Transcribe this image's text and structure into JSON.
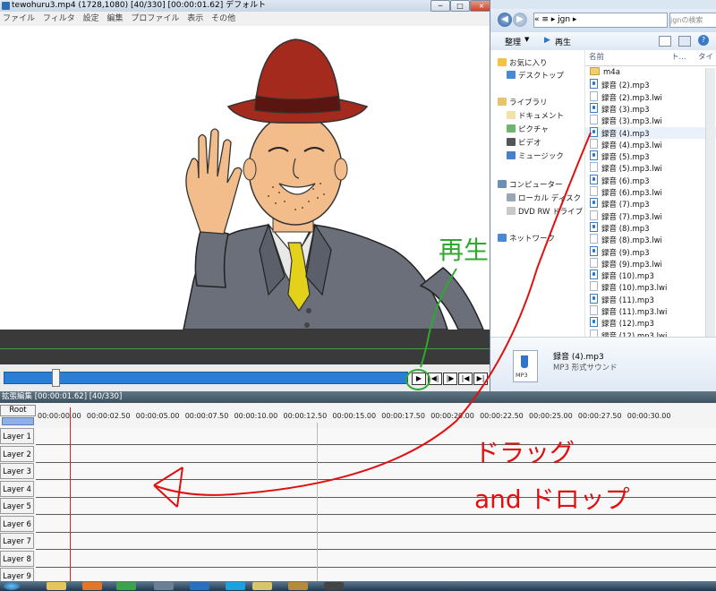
{
  "main": {
    "title": "tewohuru3.mp4 (1728,1080)  [40/330]  [00:00:01.62]  デフォルト",
    "controls": {
      "minimize": "─",
      "maximize": "□",
      "close": "×"
    },
    "menu": [
      "ファイル",
      "フィルタ",
      "設定",
      "編集",
      "プロファイル",
      "表示",
      "その他"
    ],
    "playback": {
      "play": "▶",
      "prev_frame": "◀|",
      "next_frame": "|▶",
      "to_start": "|◀",
      "to_end": "▶|"
    },
    "seek_position": 0.12
  },
  "explorer": {
    "path": "«  ≡  ▸ jgn  ▸",
    "search_placeholder": "jgnの検索",
    "toolbar": {
      "organize": "整理",
      "play": "再生"
    },
    "nav": {
      "favorites": "お気に入り",
      "desktop": "デスクトップ",
      "libraries": "ライブラリ",
      "documents": "ドキュメント",
      "pictures": "ピクチャ",
      "videos": "ビデオ",
      "music": "ミュージック",
      "computer": "コンピューター",
      "local_disk": "ローカル ディスク",
      "dvd_drive": "DVD RW ドライブ",
      "network": "ネットワーク"
    },
    "columns": {
      "name": "名前",
      "track": "ト...",
      "title": "タイ"
    },
    "files": [
      {
        "name": "m4a",
        "type": "folder"
      },
      {
        "name": "録音 (2).mp3",
        "type": "mp3"
      },
      {
        "name": "録音 (2).mp3.lwi",
        "type": "lwi"
      },
      {
        "name": "録音 (3).mp3",
        "type": "mp3"
      },
      {
        "name": "録音 (3).mp3.lwi",
        "type": "lwi"
      },
      {
        "name": "録音 (4).mp3",
        "type": "mp3"
      },
      {
        "name": "録音 (4).mp3.lwi",
        "type": "lwi"
      },
      {
        "name": "録音 (5).mp3",
        "type": "mp3"
      },
      {
        "name": "録音 (5).mp3.lwi",
        "type": "lwi"
      },
      {
        "name": "録音 (6).mp3",
        "type": "mp3"
      },
      {
        "name": "録音 (6).mp3.lwi",
        "type": "lwi"
      },
      {
        "name": "録音 (7).mp3",
        "type": "mp3"
      },
      {
        "name": "録音 (7).mp3.lwi",
        "type": "lwi"
      },
      {
        "name": "録音 (8).mp3",
        "type": "mp3"
      },
      {
        "name": "録音 (8).mp3.lwi",
        "type": "lwi"
      },
      {
        "name": "録音 (9).mp3",
        "type": "mp3"
      },
      {
        "name": "録音 (9).mp3.lwi",
        "type": "lwi"
      },
      {
        "name": "録音 (10).mp3",
        "type": "mp3"
      },
      {
        "name": "録音 (10).mp3.lwi",
        "type": "lwi"
      },
      {
        "name": "録音 (11).mp3",
        "type": "mp3"
      },
      {
        "name": "録音 (11).mp3.lwi",
        "type": "lwi"
      },
      {
        "name": "録音 (12).mp3",
        "type": "mp3"
      },
      {
        "name": "録音 (12).mp3.lwi",
        "type": "lwi"
      }
    ],
    "details": {
      "name": "録音 (4).mp3",
      "type": "MP3 形式サウンド",
      "icon_text": "MP3"
    }
  },
  "timeline": {
    "title": "拡張編集 [00:00:01.62] [40/330]",
    "root": "Root",
    "ticks": [
      "00:00:00.00",
      "00:00:02.50",
      "00:00:05.00",
      "00:00:07.50",
      "00:00:10.00",
      "00:00:12.50",
      "00:00:15.00",
      "00:00:17.50",
      "00:00:20.00",
      "00:00:22.50",
      "00:00:25.00",
      "00:00:27.50",
      "00:00:30.00"
    ],
    "layers": [
      "Layer 1",
      "Layer 2",
      "Layer 3",
      "Layer 4",
      "Layer 5",
      "Layer 6",
      "Layer 7",
      "Layer 8",
      "Layer 9"
    ]
  },
  "annotations": {
    "play": "再生",
    "drag": "ドラッグ",
    "and_drop": "and ドロップ"
  },
  "colors": {
    "annotation_red": "#e01010",
    "annotation_green": "#2ea82e",
    "seek_blue": "#2a7fd4",
    "cursor_red": "#e02020"
  }
}
